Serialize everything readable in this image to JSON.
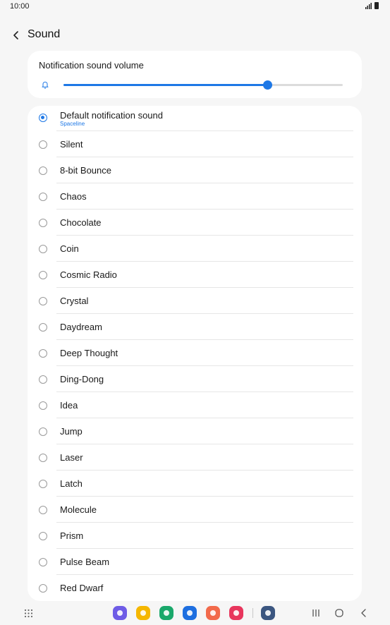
{
  "status_bar": {
    "time": "10:00"
  },
  "header": {
    "title": "Sound"
  },
  "volume": {
    "label": "Notification sound volume",
    "level": 0.73
  },
  "sounds": [
    {
      "label": "Default notification sound",
      "sub": "Spaceline",
      "selected": true
    },
    {
      "label": "Silent"
    },
    {
      "label": "8-bit Bounce"
    },
    {
      "label": "Chaos"
    },
    {
      "label": "Chocolate"
    },
    {
      "label": "Coin"
    },
    {
      "label": "Cosmic Radio"
    },
    {
      "label": "Crystal"
    },
    {
      "label": "Daydream"
    },
    {
      "label": "Deep Thought"
    },
    {
      "label": "Ding-Dong"
    },
    {
      "label": "Idea"
    },
    {
      "label": "Jump"
    },
    {
      "label": "Laser"
    },
    {
      "label": "Latch"
    },
    {
      "label": "Molecule"
    },
    {
      "label": "Prism"
    },
    {
      "label": "Pulse Beam"
    },
    {
      "label": "Red Dwarf"
    }
  ],
  "dock": [
    {
      "name": "internet-app-icon",
      "color": "#6e5ce6"
    },
    {
      "name": "my-files-app-icon",
      "color": "#f5b700"
    },
    {
      "name": "phone-app-icon",
      "color": "#1aa86b"
    },
    {
      "name": "messages-app-icon",
      "color": "#1e6fe0"
    },
    {
      "name": "contacts-app-icon",
      "color": "#f26a4b"
    },
    {
      "name": "screen-recorder-app-icon",
      "color": "#e8365d"
    },
    {
      "name": "settings-app-icon",
      "color": "#3b5680"
    }
  ],
  "colors": {
    "accent": "#1e78e6",
    "background": "#f6f6f6",
    "card": "#ffffff"
  }
}
